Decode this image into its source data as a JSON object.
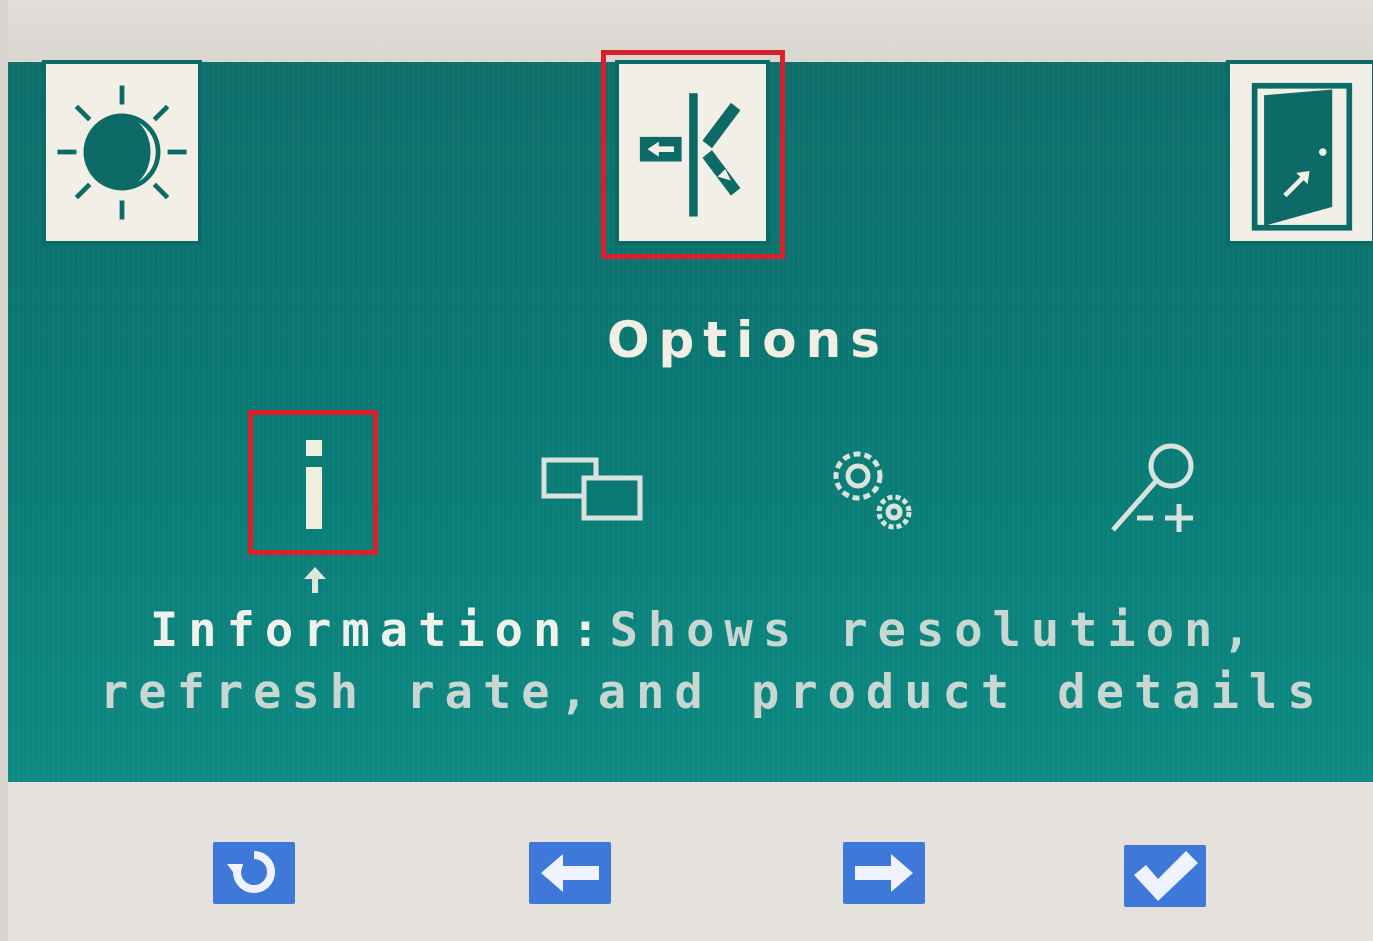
{
  "osd": {
    "menu_title": "Options",
    "selected_top_menu": "Options",
    "selected_submenu": "Information",
    "description_label": "Information:",
    "description_line1_rest": "Shows resolution,",
    "description_line2": "refresh rate,and product details"
  },
  "top_menu": [
    {
      "icon": "brightness-contrast-icon"
    },
    {
      "icon": "options-icon"
    },
    {
      "icon": "exit-icon"
    }
  ],
  "submenu": [
    {
      "icon": "information-icon",
      "glyph": "i"
    },
    {
      "icon": "window-position-icon"
    },
    {
      "icon": "settings-gears-icon"
    },
    {
      "icon": "zoom-icon"
    }
  ],
  "buttons": [
    {
      "icon": "back-icon"
    },
    {
      "icon": "left-arrow-icon"
    },
    {
      "icon": "right-arrow-icon"
    },
    {
      "icon": "confirm-check-icon"
    }
  ],
  "colors": {
    "osd_background": "#0a7873",
    "selection": "#d8212b",
    "button": "#3e78d8",
    "text": "#f1eee4"
  }
}
